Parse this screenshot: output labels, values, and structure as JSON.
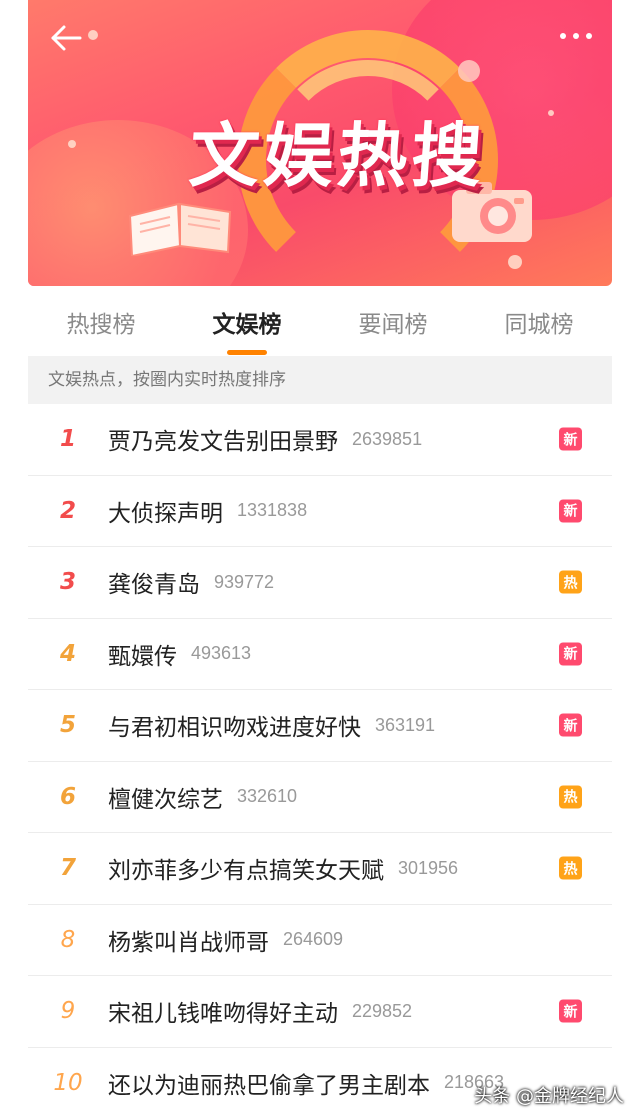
{
  "header": {
    "title": "文娱热搜",
    "back_icon": "back-arrow-icon",
    "more_icon": "more-dots-icon"
  },
  "tabs": [
    {
      "label": "热搜榜",
      "active": false
    },
    {
      "label": "文娱榜",
      "active": true
    },
    {
      "label": "要闻榜",
      "active": false
    },
    {
      "label": "同城榜",
      "active": false
    }
  ],
  "subheader": "文娱热点，按圈内实时热度排序",
  "items": [
    {
      "rank": "1",
      "topic": "贾乃亮发文告别田景野",
      "count": "2639851",
      "badge": "新"
    },
    {
      "rank": "2",
      "topic": "大侦探声明",
      "count": "1331838",
      "badge": "新"
    },
    {
      "rank": "3",
      "topic": "龚俊青岛",
      "count": "939772",
      "badge": "热"
    },
    {
      "rank": "4",
      "topic": "甄嬛传",
      "count": "493613",
      "badge": "新"
    },
    {
      "rank": "5",
      "topic": "与君初相识吻戏进度好快",
      "count": "363191",
      "badge": "新"
    },
    {
      "rank": "6",
      "topic": "檀健次综艺",
      "count": "332610",
      "badge": "热"
    },
    {
      "rank": "7",
      "topic": "刘亦菲多少有点搞笑女天赋",
      "count": "301956",
      "badge": "热"
    },
    {
      "rank": "8",
      "topic": "杨紫叫肖战师哥",
      "count": "264609",
      "badge": ""
    },
    {
      "rank": "9",
      "topic": "宋祖儿钱唯吻得好主动",
      "count": "229852",
      "badge": "新"
    },
    {
      "rank": "10",
      "topic": "还以为迪丽热巴偷拿了男主剧本",
      "count": "218663",
      "badge": ""
    }
  ],
  "watermark": "头条 @金牌经纪人",
  "colors": {
    "accent": "#ff8200",
    "rank_top": "#f24c4c",
    "rank_rest": "#f2a33a",
    "badge_new": "#ff4a6e",
    "badge_hot": "#ffa318"
  }
}
